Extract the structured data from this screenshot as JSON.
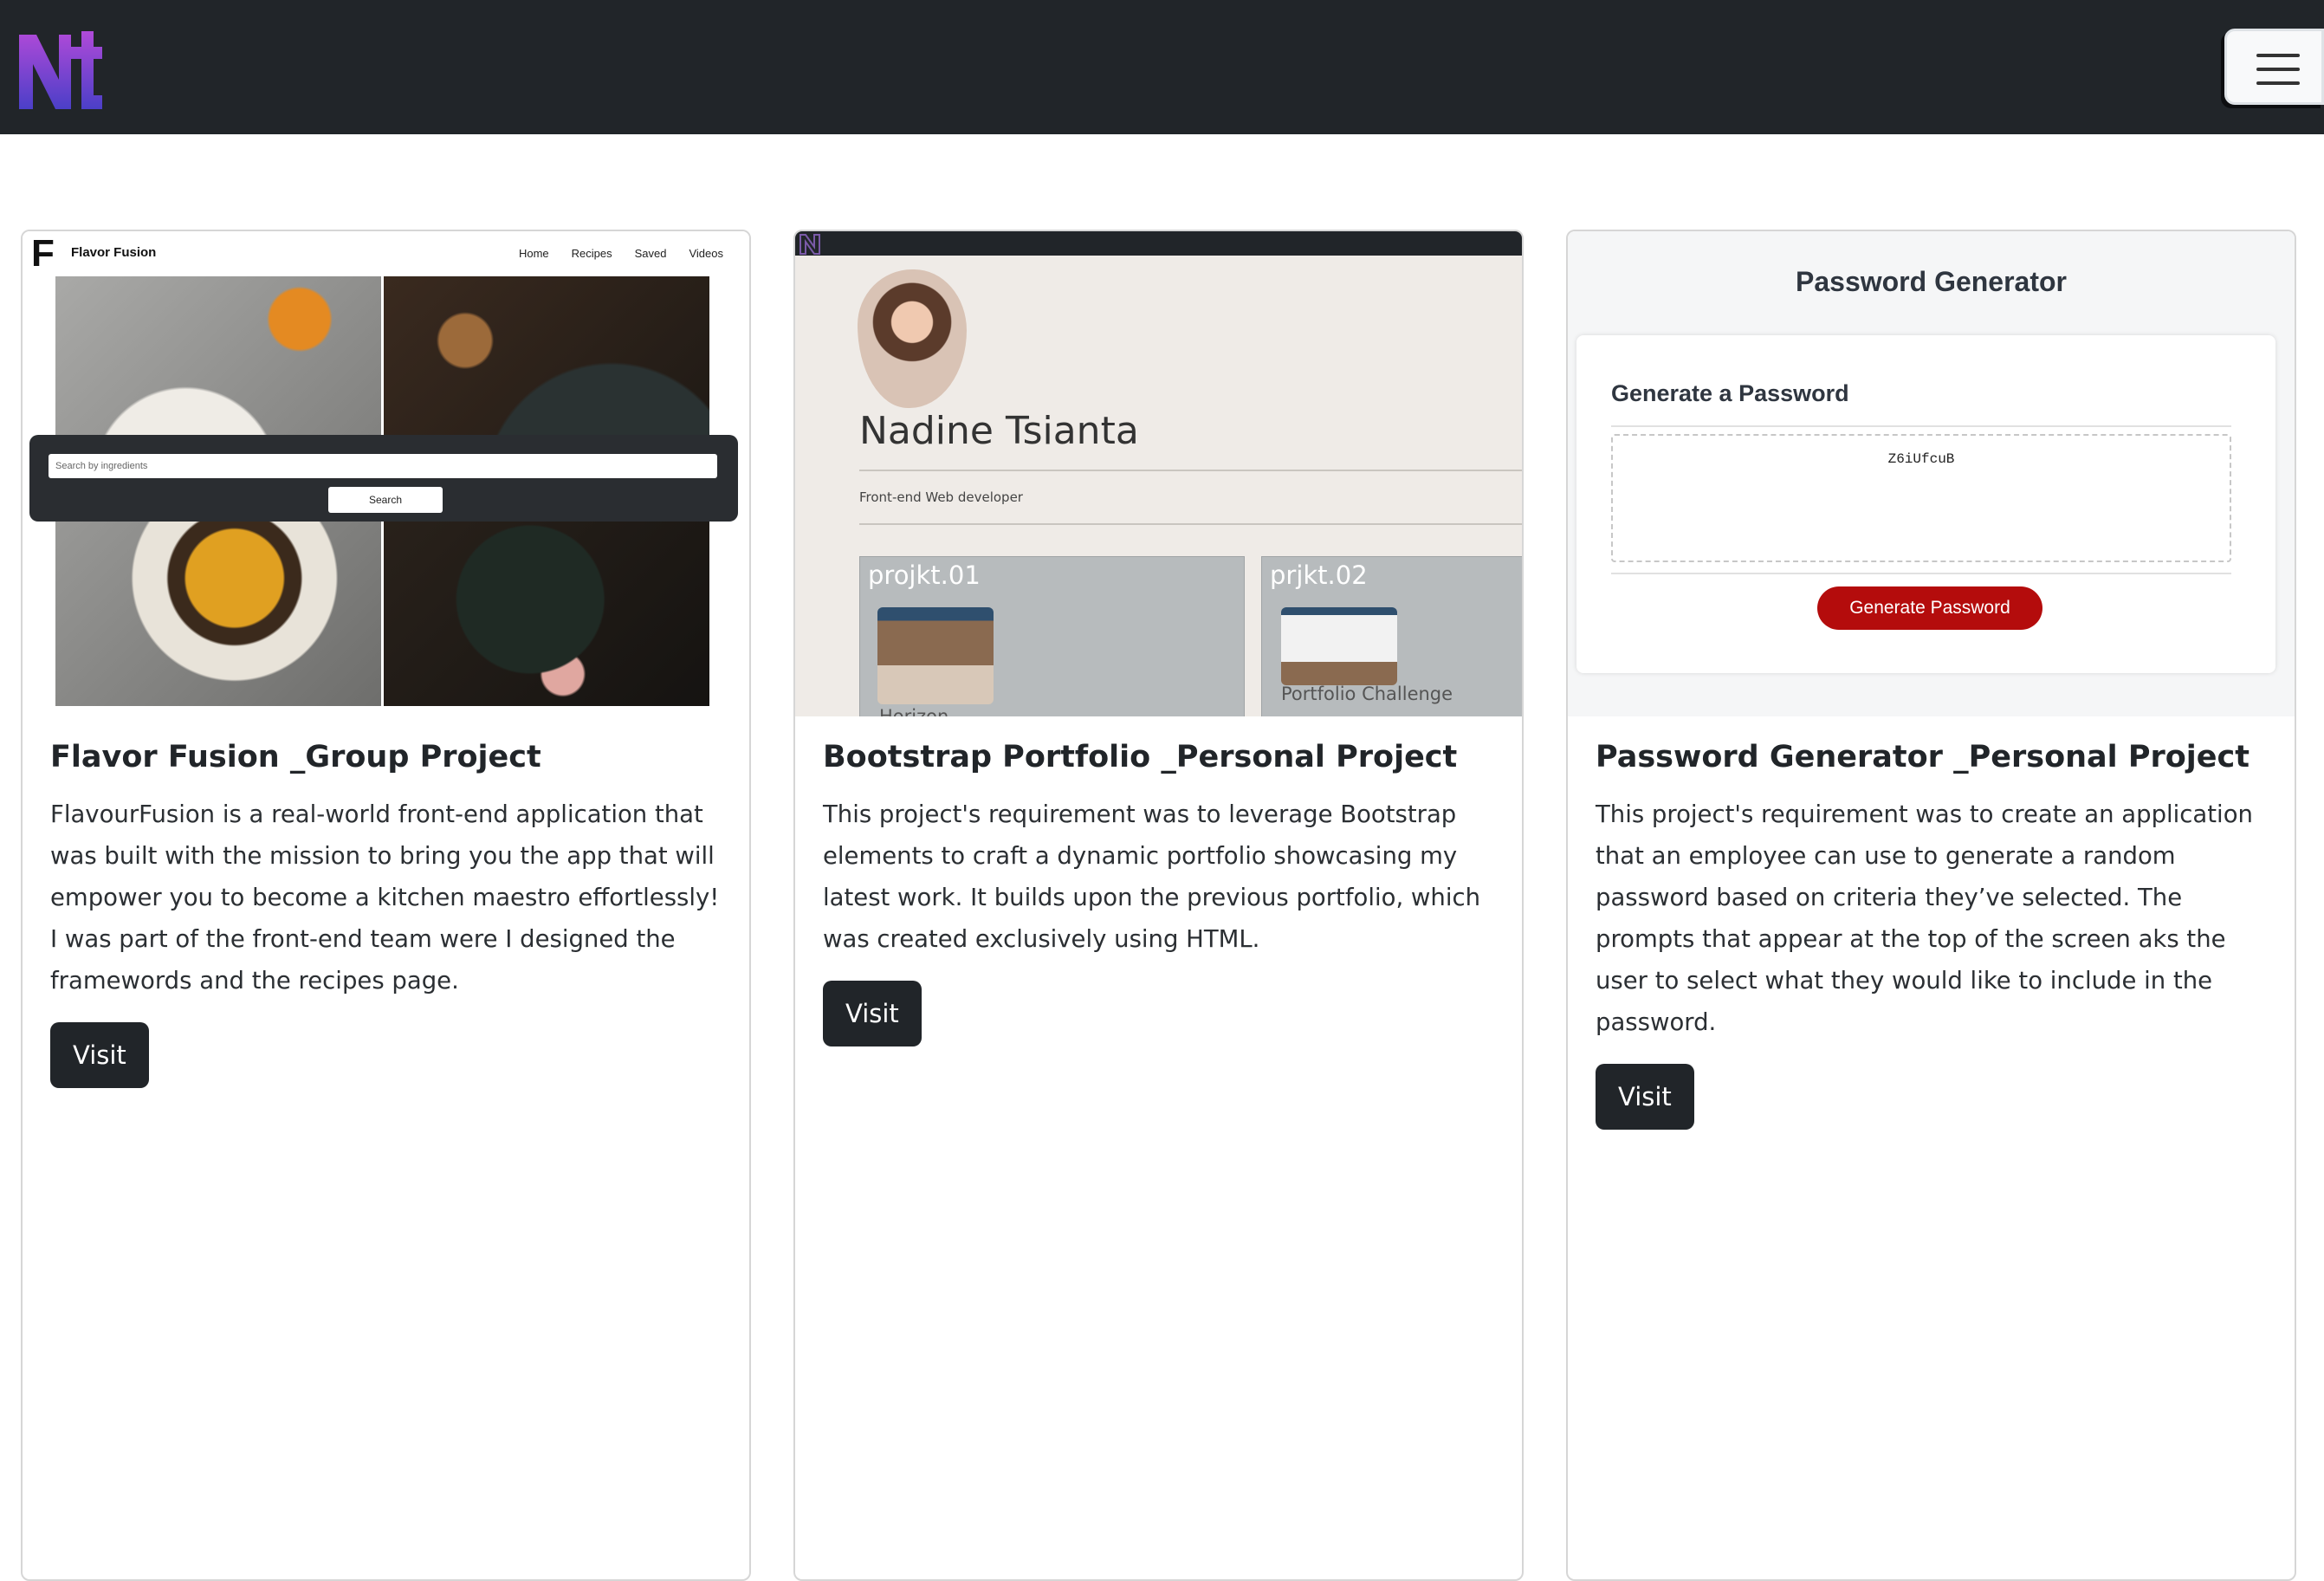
{
  "navbar": {
    "logo_text": "Nt",
    "menu_icon": "hamburger-icon"
  },
  "projects": [
    {
      "title": "Flavor Fusion _Group Project",
      "description": "FlavourFusion is a real-world front-end application that was built with the mission to bring you the app that will empower you to become a kitchen maestro effortlessly! I was part of the front-end team were I designed the framewords and the recipes page.",
      "button": "Visit",
      "preview": {
        "brand": "Flavor Fusion",
        "logo": "F",
        "nav": [
          "Home",
          "Recipes",
          "Saved",
          "Videos"
        ],
        "search_placeholder": "Search by ingredients",
        "search_button": "Search"
      }
    },
    {
      "title": "Bootstrap Portfolio _Personal Project",
      "description": "This project's requirement was to leverage Bootstrap elements to craft a dynamic portfolio showcasing my latest work. It builds upon the previous portfolio, which was created exclusively using HTML.",
      "button": "Visit",
      "preview": {
        "name": "Nadine Tsianta",
        "role": "Front-end Web developer",
        "project1_title": "projkt.01",
        "project1_caption": "Horizon",
        "project2_title": "prjkt.02",
        "project2_caption": "Portfolio Challenge"
      }
    },
    {
      "title": "Password Generator _Personal Project",
      "description": "This project's requirement was to create an application that an employee can use to generate a random password based on criteria they’ve selected. The prompts that appear at the top of the screen aks the user to select what they would like to include in the password.",
      "button": "Visit",
      "preview": {
        "header": "Password Generator",
        "subheader": "Generate a Password",
        "password": "Z6iUfcuB",
        "button": "Generate Password"
      }
    }
  ],
  "colors": {
    "navbar_bg": "#212529",
    "button_bg": "#212529",
    "generate_button": "#b40c0c"
  }
}
